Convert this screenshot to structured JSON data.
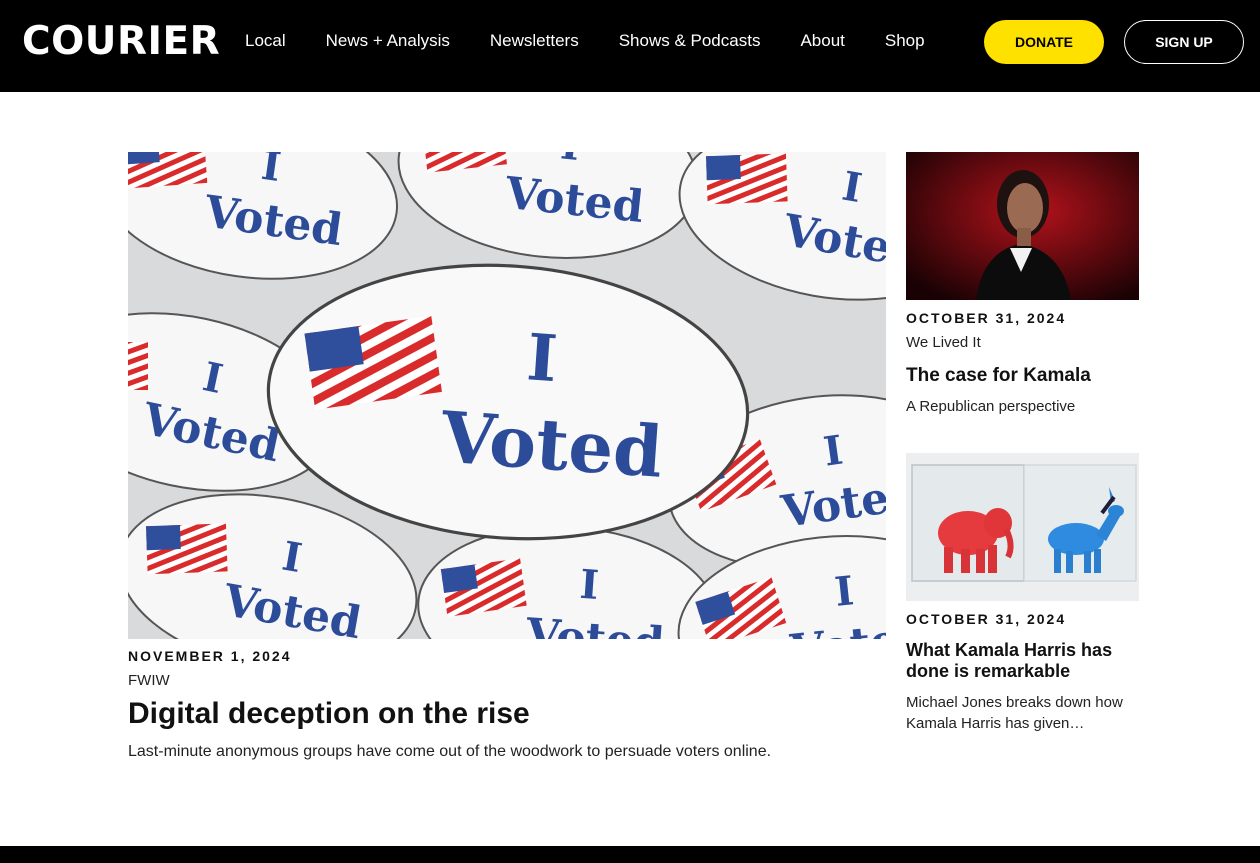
{
  "header": {
    "logo": "COURIER",
    "nav": [
      "Local",
      "News + Analysis",
      "Newsletters",
      "Shows & Podcasts",
      "About",
      "Shop"
    ],
    "donate_label": "DONATE",
    "signup_label": "SIGN UP",
    "accent_color": "#ffe100"
  },
  "feature": {
    "date": "NOVEMBER 1, 2024",
    "category": "FWIW",
    "title": "Digital deception on the rise",
    "description": "Last-minute anonymous groups have come out of the woodwork to persuade voters online.",
    "image_alt": "I Voted stickers",
    "sticker_text": "I Voted"
  },
  "side": [
    {
      "date": "OCTOBER 31, 2024",
      "category": "We Lived It",
      "title": "The case for Kamala",
      "description": "A Republican perspective",
      "image_alt": "Kamala Harris portrait"
    },
    {
      "date": "OCTOBER 31, 2024",
      "title": "What Kamala Harris has done is remarkable",
      "description": "Michael Jones breaks down how Kamala Harris has given…",
      "image_alt": "Elephant and donkey figurines"
    }
  ]
}
